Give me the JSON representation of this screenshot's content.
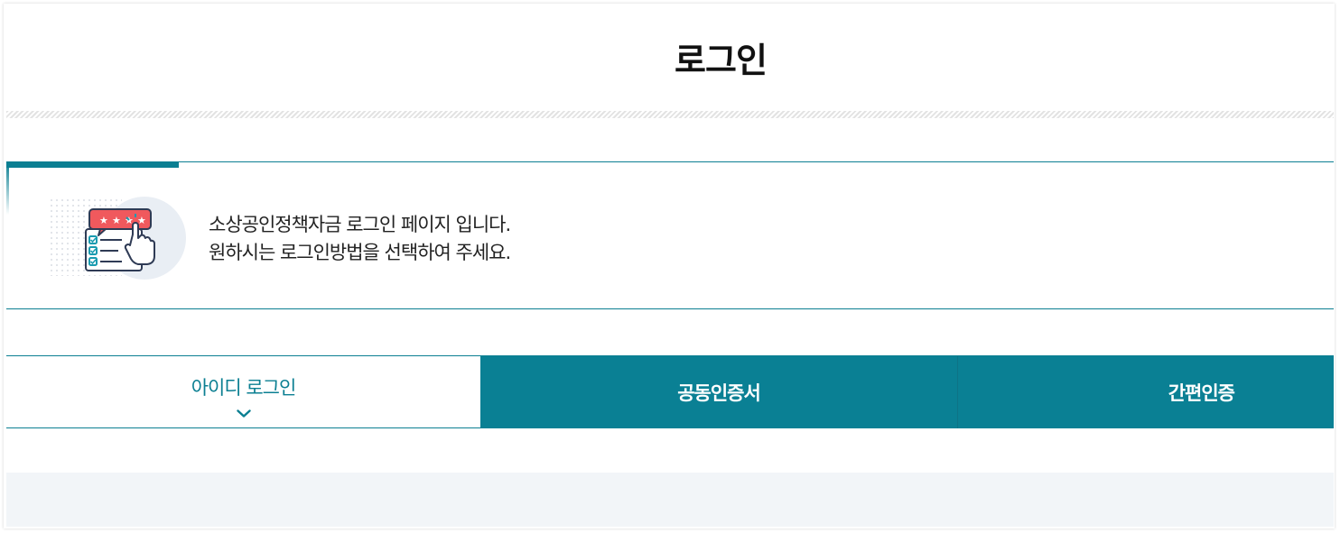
{
  "page": {
    "title": "로그인"
  },
  "info": {
    "line1": "소상공인정책자금 로그인 페이지 입니다.",
    "line2": "원하시는 로그인방법을 선택하여 주세요.",
    "icon": "review-checklist-icon"
  },
  "tabs": [
    {
      "label": "아이디 로그인",
      "active": true
    },
    {
      "label": "공동인증서",
      "active": false
    },
    {
      "label": "간편인증",
      "active": false
    }
  ],
  "colors": {
    "accent": "#0b7f92",
    "tab_background": "#0a8094",
    "panel_background": "#f2f5f8"
  }
}
